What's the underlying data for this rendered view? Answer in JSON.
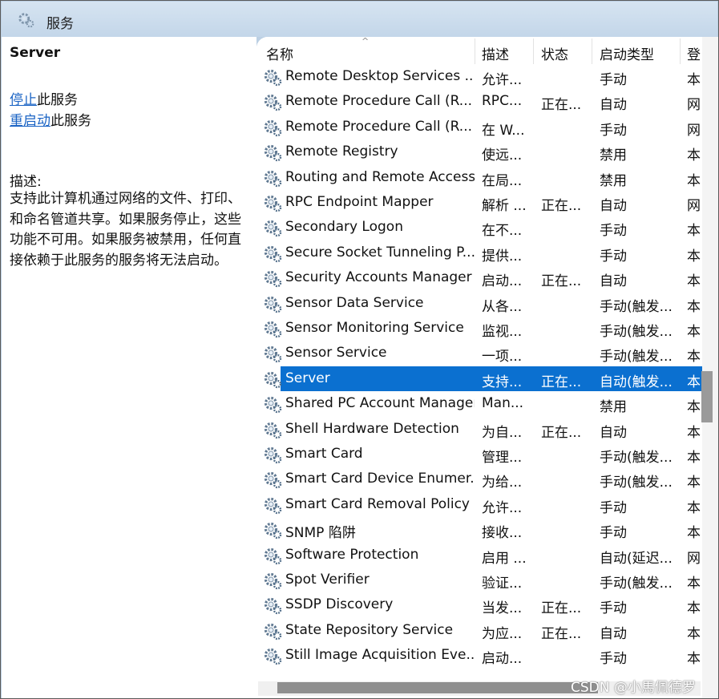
{
  "window": {
    "title": "服务",
    "icon": "gear-icon"
  },
  "left_pane": {
    "service_name": "Server",
    "stop": {
      "link": "停止",
      "suffix": "此服务"
    },
    "restart": {
      "link": "重启动",
      "suffix": "此服务"
    },
    "description_label": "描述:",
    "description": "支持此计算机通过网络的文件、打印、和命名管道共享。如果服务停止，这些功能不可用。如果服务被禁用，任何直接依赖于此服务的服务将无法启动。"
  },
  "columns": {
    "name": "名称",
    "desc": "描述",
    "status": "状态",
    "startup": "启动类型",
    "login": "登"
  },
  "sort": {
    "column": "name",
    "indicator": "^"
  },
  "services": [
    {
      "name": "Remote Desktop Services ...",
      "desc": "允许...",
      "status": "",
      "startup": "手动",
      "login": "本"
    },
    {
      "name": "Remote Procedure Call (R...",
      "desc": "RPC...",
      "status": "正在...",
      "startup": "自动",
      "login": "网"
    },
    {
      "name": "Remote Procedure Call (R...",
      "desc": "在 W...",
      "status": "",
      "startup": "手动",
      "login": "网"
    },
    {
      "name": "Remote Registry",
      "desc": "使远...",
      "status": "",
      "startup": "禁用",
      "login": "本"
    },
    {
      "name": "Routing and Remote Access",
      "desc": "在局...",
      "status": "",
      "startup": "禁用",
      "login": "本"
    },
    {
      "name": "RPC Endpoint Mapper",
      "desc": "解析 ...",
      "status": "正在...",
      "startup": "自动",
      "login": "网"
    },
    {
      "name": "Secondary Logon",
      "desc": "在不...",
      "status": "",
      "startup": "手动",
      "login": "本"
    },
    {
      "name": "Secure Socket Tunneling P...",
      "desc": "提供...",
      "status": "",
      "startup": "手动",
      "login": "本"
    },
    {
      "name": "Security Accounts Manager",
      "desc": "启动...",
      "status": "正在...",
      "startup": "自动",
      "login": "本"
    },
    {
      "name": "Sensor Data Service",
      "desc": "从各...",
      "status": "",
      "startup": "手动(触发...",
      "login": "本"
    },
    {
      "name": "Sensor Monitoring Service",
      "desc": "监视...",
      "status": "",
      "startup": "手动(触发...",
      "login": "本"
    },
    {
      "name": "Sensor Service",
      "desc": "一项...",
      "status": "",
      "startup": "手动(触发...",
      "login": "本"
    },
    {
      "name": "Server",
      "desc": "支持...",
      "status": "正在...",
      "startup": "自动(触发...",
      "login": "本",
      "selected": true
    },
    {
      "name": "Shared PC Account Manager",
      "desc": "Man...",
      "status": "",
      "startup": "禁用",
      "login": "本"
    },
    {
      "name": "Shell Hardware Detection",
      "desc": "为自...",
      "status": "正在...",
      "startup": "自动",
      "login": "本"
    },
    {
      "name": "Smart Card",
      "desc": "管理...",
      "status": "",
      "startup": "手动(触发...",
      "login": "本"
    },
    {
      "name": "Smart Card Device Enumer...",
      "desc": "为给...",
      "status": "",
      "startup": "手动(触发...",
      "login": "本"
    },
    {
      "name": "Smart Card Removal Policy",
      "desc": "允许...",
      "status": "",
      "startup": "手动",
      "login": "本"
    },
    {
      "name": "SNMP 陷阱",
      "desc": "接收...",
      "status": "",
      "startup": "手动",
      "login": "本"
    },
    {
      "name": "Software Protection",
      "desc": "启用 ...",
      "status": "",
      "startup": "自动(延迟...",
      "login": "网"
    },
    {
      "name": "Spot Verifier",
      "desc": "验证...",
      "status": "",
      "startup": "手动(触发...",
      "login": "本"
    },
    {
      "name": "SSDP Discovery",
      "desc": "当发...",
      "status": "正在...",
      "startup": "手动",
      "login": "本"
    },
    {
      "name": "State Repository Service",
      "desc": "为应...",
      "status": "正在...",
      "startup": "自动",
      "login": "本"
    },
    {
      "name": "Still Image Acquisition Eve...",
      "desc": "启动...",
      "status": "",
      "startup": "手动",
      "login": "本"
    }
  ],
  "service_icon": "service-gear-icon",
  "watermark": "CSDN @小馬佩德罗",
  "colors": {
    "selection": "#0b70d0",
    "link": "#1a63c4",
    "chrome": "#bcd0e4"
  }
}
